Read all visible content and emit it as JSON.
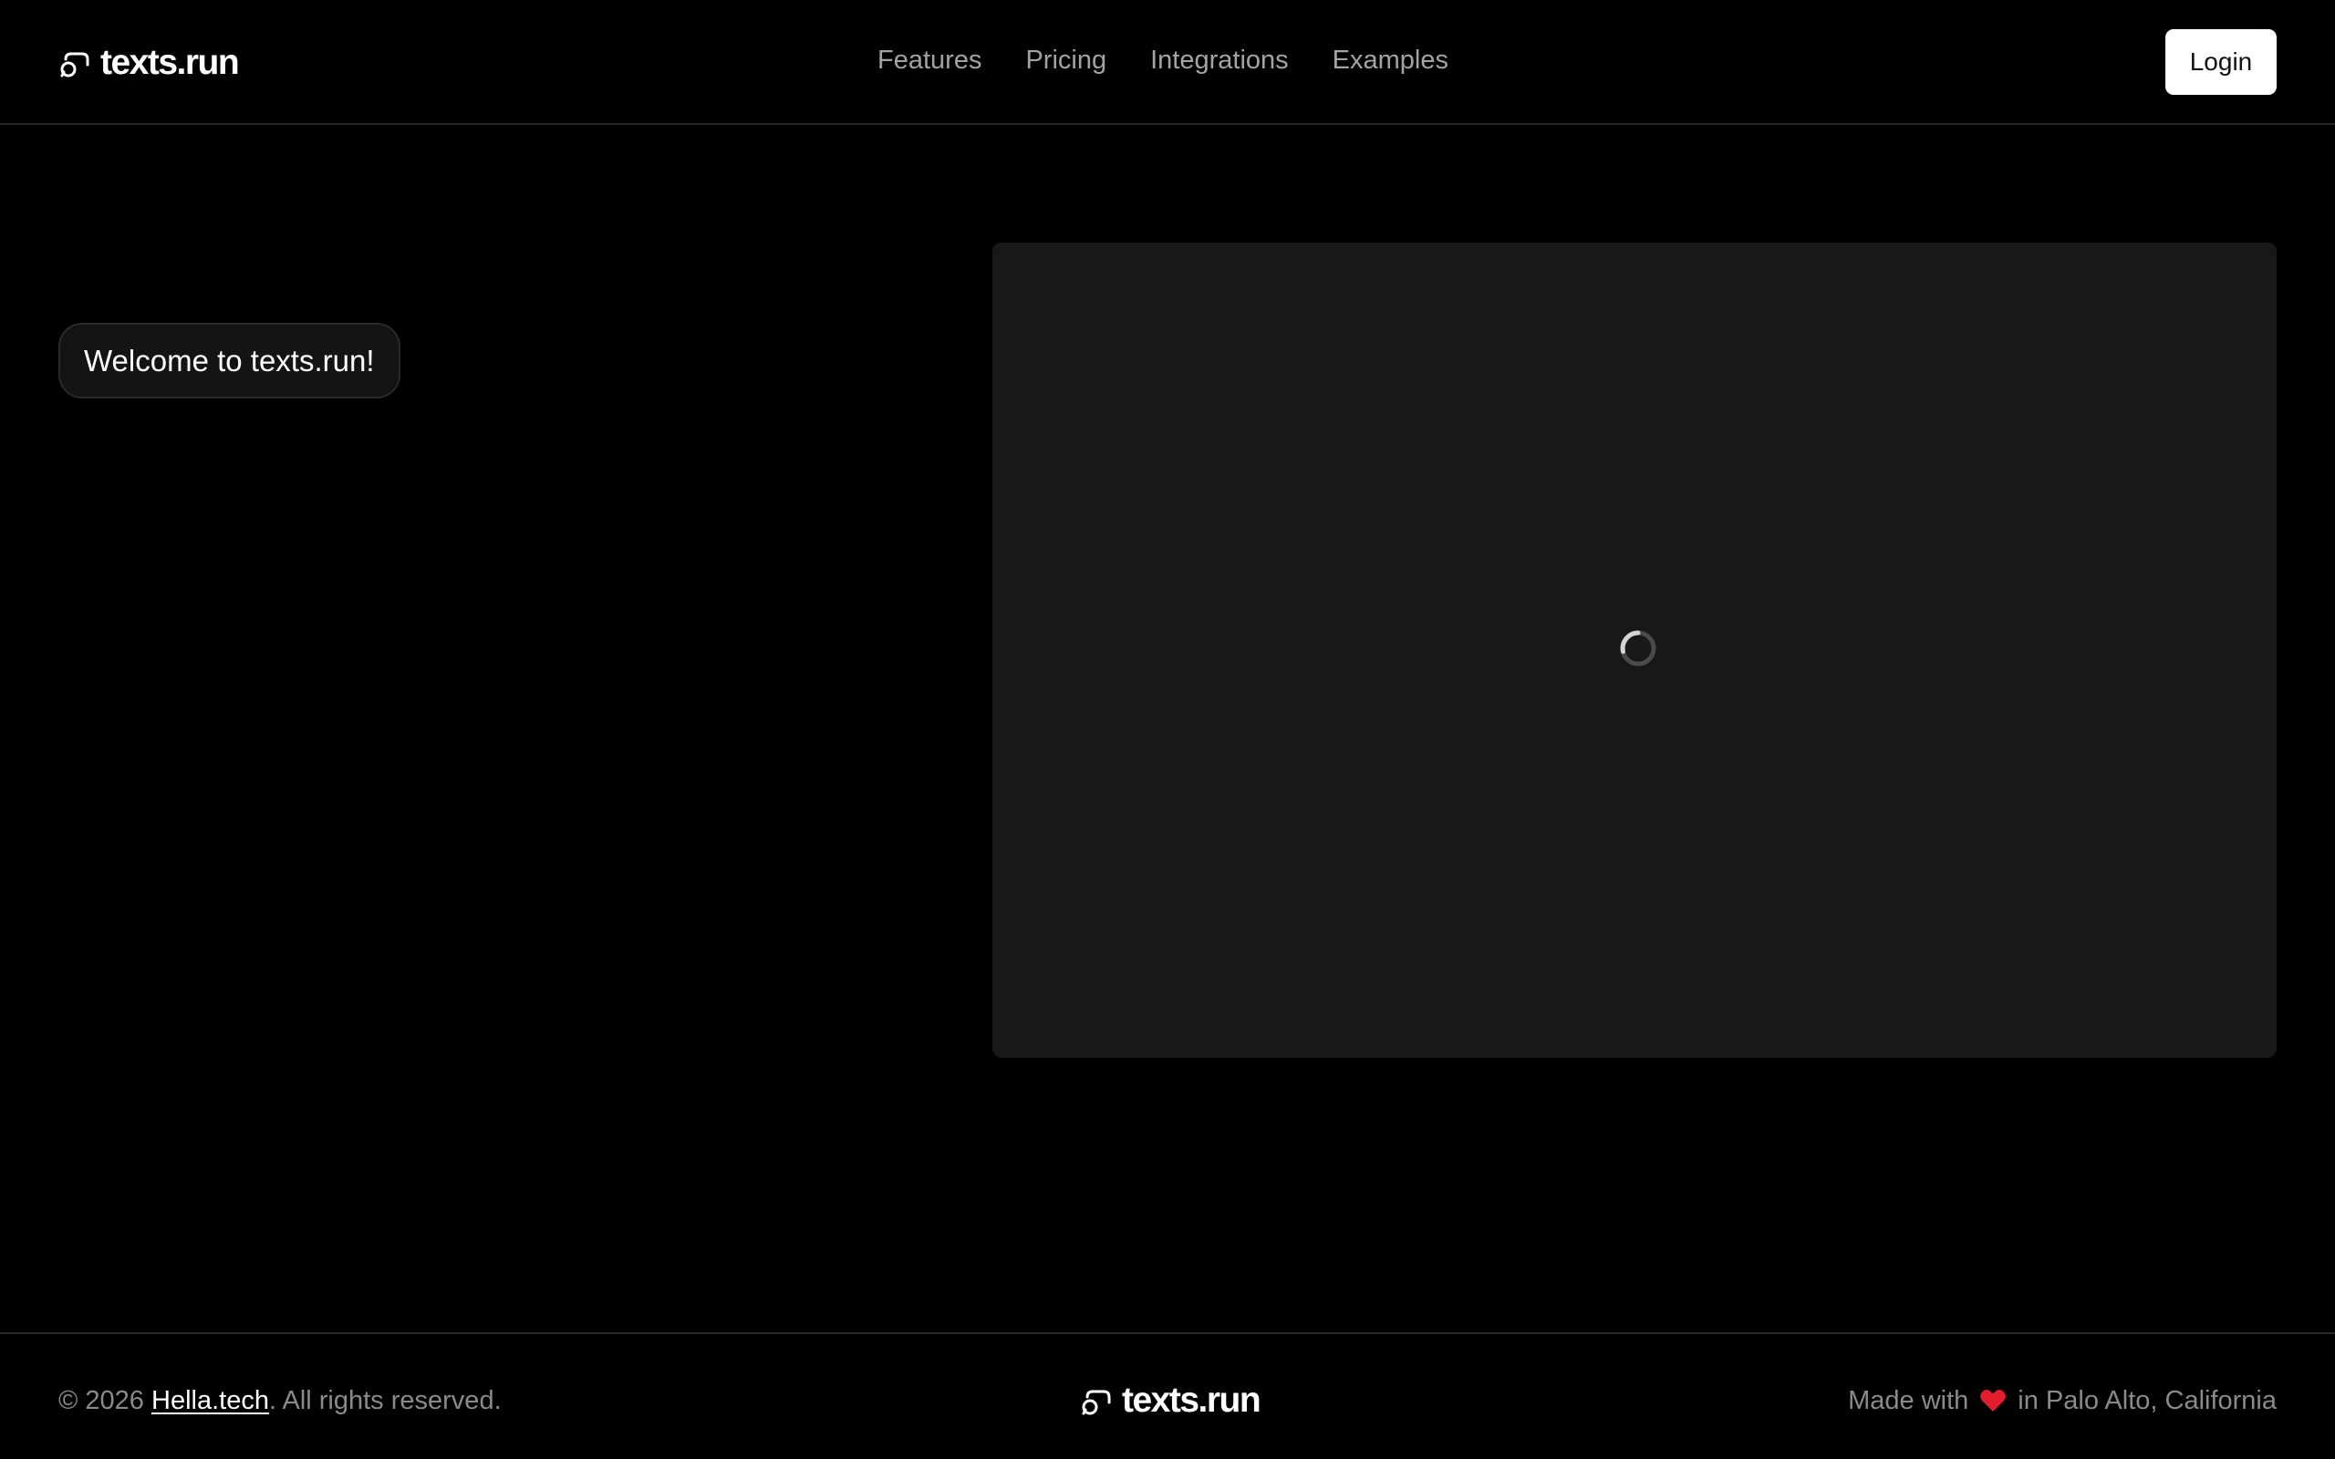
{
  "header": {
    "logo_text": "texts.run",
    "nav": [
      {
        "label": "Features"
      },
      {
        "label": "Pricing"
      },
      {
        "label": "Integrations"
      },
      {
        "label": "Examples"
      }
    ],
    "login_label": "Login"
  },
  "main": {
    "welcome_message": "Welcome to texts.run!",
    "preview": {
      "state": "loading",
      "icon": "loading-spinner-icon"
    }
  },
  "footer": {
    "copyright_prefix": "© 2026 ",
    "company_link": "Hella.tech",
    "copyright_suffix": ". All rights reserved.",
    "logo_text": "texts.run",
    "made_with_prefix": "Made with",
    "made_with_suffix": "in Palo Alto, California",
    "heart_icon": "heart-icon"
  },
  "colors": {
    "background": "#000000",
    "panel": "#181818",
    "nav_text": "#a3a3a3",
    "muted_text": "#8a8a8a",
    "heart": "#e11d2e",
    "login_bg": "#ffffff"
  }
}
